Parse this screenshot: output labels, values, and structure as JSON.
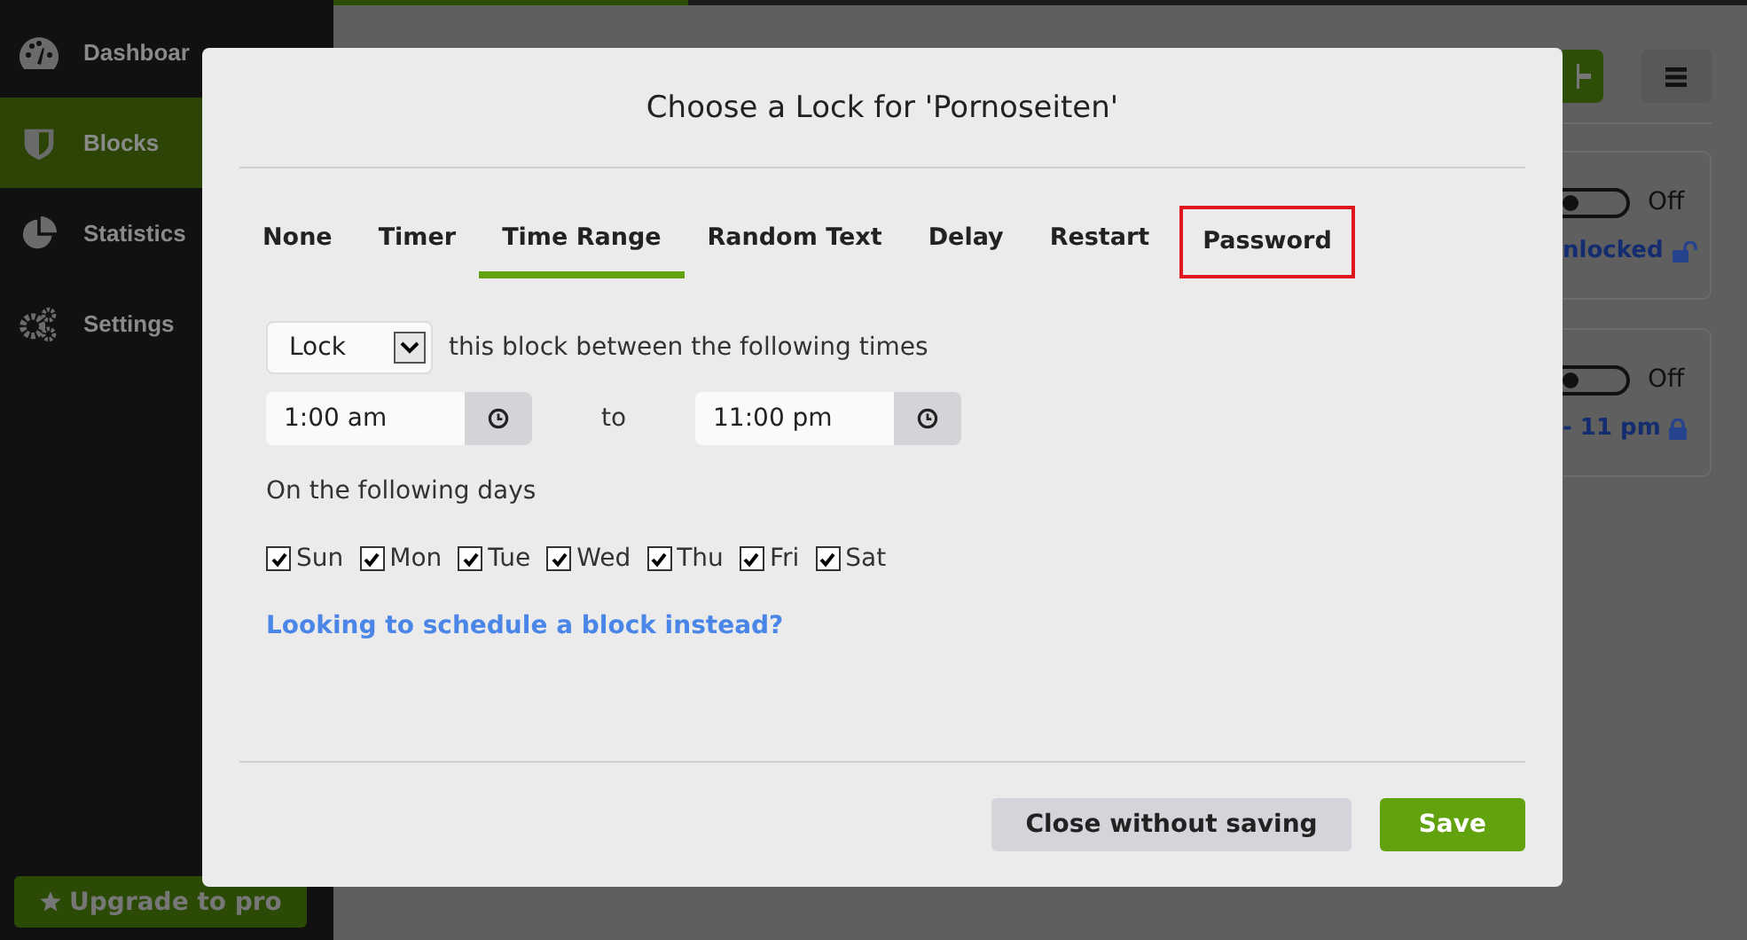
{
  "sidebar": {
    "items": [
      {
        "label": "Dashboar",
        "selected": false
      },
      {
        "label": "Blocks",
        "selected": true
      },
      {
        "label": "Statistics",
        "selected": false
      },
      {
        "label": "Settings",
        "selected": false
      }
    ],
    "upgrade_button": "Upgrade to pro"
  },
  "background_cards": [
    {
      "toggle_on": false,
      "state": "Off",
      "status": "nlocked",
      "locked": false
    },
    {
      "toggle_on": false,
      "state": "Off",
      "status": "- 11 pm",
      "locked": true
    }
  ],
  "dialog": {
    "title": "Choose a Lock for 'Pornoseiten'",
    "tabs": [
      {
        "label": "None",
        "selected": false,
        "highlighted": false
      },
      {
        "label": "Timer",
        "selected": false,
        "highlighted": false
      },
      {
        "label": "Time Range",
        "selected": true,
        "highlighted": false
      },
      {
        "label": "Random Text",
        "selected": false,
        "highlighted": false
      },
      {
        "label": "Delay",
        "selected": false,
        "highlighted": false
      },
      {
        "label": "Restart",
        "selected": false,
        "highlighted": false
      },
      {
        "label": "Password",
        "selected": false,
        "highlighted": true
      }
    ],
    "mode_select": "Lock",
    "mode_text": "this block between the following times",
    "start_time": "1:00 am",
    "to_label": "to",
    "end_time": "11:00 pm",
    "days_label": "On the following days",
    "days": [
      {
        "label": "Sun",
        "checked": true
      },
      {
        "label": "Mon",
        "checked": true
      },
      {
        "label": "Tue",
        "checked": true
      },
      {
        "label": "Wed",
        "checked": true
      },
      {
        "label": "Thu",
        "checked": true
      },
      {
        "label": "Fri",
        "checked": true
      },
      {
        "label": "Sat",
        "checked": true
      }
    ],
    "link": "Looking to schedule a block instead?",
    "buttons": [
      {
        "label": "Close without saving",
        "kind": "secondary"
      },
      {
        "label": "Save",
        "kind": "primary"
      }
    ]
  }
}
